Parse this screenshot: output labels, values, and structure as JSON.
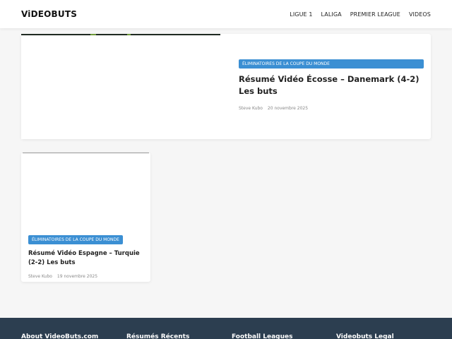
{
  "site": {
    "logo": "ViDEOBUTS"
  },
  "nav": {
    "items": [
      {
        "label": "LIGUE 1"
      },
      {
        "label": "LALIGA"
      },
      {
        "label": "PREMIER LEAGUE"
      },
      {
        "label": "VIDEOS"
      }
    ]
  },
  "featured": {
    "category": "ÉLIMINATOIRES DE LA COUPE DU MONDE",
    "title": "Résumé Vidéo Écosse – Danemark (4-2) Les buts",
    "author": "Steve Kubo",
    "date": "20 novembre 2025"
  },
  "card": {
    "category": "ÉLIMINATOIRES DE LA COUPE DU MONDE",
    "title": "Résumé Vidéo Espagne – Turquie (2-2) Les buts",
    "author": "Steve Kubo",
    "date": "19 novembre 2025"
  },
  "footer": {
    "columns": [
      {
        "heading": "About VideoButs.com"
      },
      {
        "heading": "Résumés Récents"
      },
      {
        "heading": "Football Leagues"
      },
      {
        "heading": "Videobuts Legal"
      }
    ]
  },
  "colors": {
    "category_badge": "#3b8fd3",
    "footer_bg": "#2c3e50",
    "page_bg": "#f6f6f6"
  }
}
